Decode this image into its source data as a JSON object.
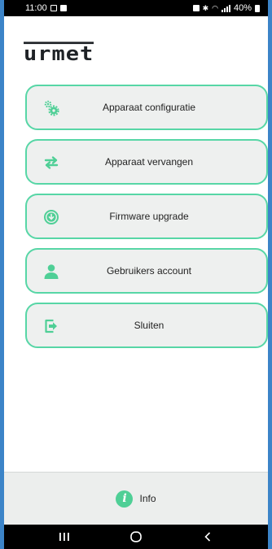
{
  "status_bar": {
    "time": "11:00",
    "battery_text": "40%"
  },
  "logo": {
    "text": "urmet"
  },
  "menu": {
    "items": [
      {
        "label": "Apparaat configuratie",
        "icon": "gears-icon"
      },
      {
        "label": "Apparaat vervangen",
        "icon": "swap-arrows-icon"
      },
      {
        "label": "Firmware upgrade",
        "icon": "download-circle-icon"
      },
      {
        "label": "Gebruikers account",
        "icon": "user-icon"
      },
      {
        "label": "Sluiten",
        "icon": "exit-icon"
      }
    ]
  },
  "info": {
    "label": "Info",
    "icon_glyph": "i"
  },
  "colors": {
    "accent": "#57d6a6",
    "icon_green": "#4fcf96",
    "button_bg": "#eef0ef",
    "frame": "#3c84c8"
  }
}
